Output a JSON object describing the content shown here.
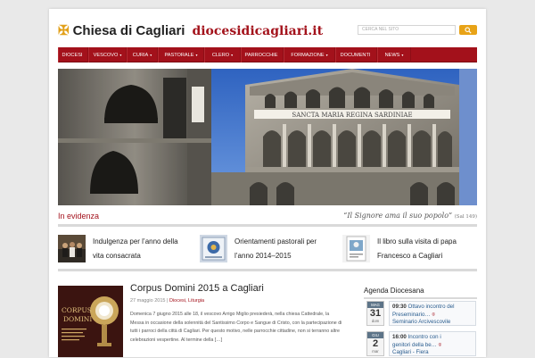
{
  "header": {
    "site_name": "Chiesa di Cagliari",
    "site_url": "diocesidicagliari.it",
    "search_placeholder": "CERCA NEL SITO"
  },
  "nav": {
    "items": [
      {
        "label": "DIOCESI",
        "caret": ""
      },
      {
        "label": "VESCOVO",
        "caret": "▾"
      },
      {
        "label": "CURIA",
        "caret": "▾"
      },
      {
        "label": "PASTORALE",
        "caret": "▾"
      },
      {
        "label": "CLERO",
        "caret": "▾"
      },
      {
        "label": "PARROCCHIE",
        "caret": ""
      },
      {
        "label": "FORMAZIONE",
        "caret": "▾"
      },
      {
        "label": "DOCUMENTI",
        "caret": ""
      },
      {
        "label": "NEWS",
        "caret": "▾"
      }
    ]
  },
  "hero": {
    "facade_inscription": "SANCTA MARIA REGINA SARDINIAE"
  },
  "evidenza": {
    "title": "In evidenza",
    "quote": "“Il Signore ama il suo popolo”",
    "quote_ref": "(Sal 149)",
    "items": [
      {
        "line1": "Indulgenza per l’anno della",
        "line2": "vita consacrata"
      },
      {
        "line1": "Orientamenti pastorali per",
        "line2": "l’anno 2014–2015"
      },
      {
        "line1": "Il libro sulla visita di papa",
        "line2": "Francesco a Cagliari"
      }
    ]
  },
  "article": {
    "title": "Corpus Domini 2015 a Cagliari",
    "date": "27 maggio 2015",
    "separator": " | ",
    "categories": "Diocesi, Liturgia",
    "body": "Domenica 7 giugno 2015 alle 18, il vescovo Arrigo Miglio presiederà, nella chiesa Cattedrale, la Messa in occasione della solennità del Santissimo Corpo e Sangue di Cristo, con la partecipazione di tutti i parroci della città di Cagliari. Per questo motivo, nelle parrocchie cittadine, non si terranno altre celebrazioni vespertine. Al termine della […]",
    "thumb_text_line1": "CORPUS",
    "thumb_text_line2": "DOMINI"
  },
  "agenda": {
    "title": "Agenda Diocesana",
    "events": [
      {
        "month": "MAG",
        "day": "31",
        "weekday": "dom",
        "time": "09:30",
        "title_a": " Ottavo incontro del",
        "title_b": "Preseminario… ",
        "location": "Seminario Arcivescovile"
      },
      {
        "month": "GIU",
        "day": "2",
        "weekday": "mar",
        "time": "16:00",
        "title_a": " Incontro con i",
        "title_b": "genitori della be… ",
        "location": "Cagliari - Fiera"
      }
    ]
  },
  "colors": {
    "brand_red": "#a3111b",
    "accent_orange": "#e8a317",
    "link_blue": "#2a5d8f"
  }
}
